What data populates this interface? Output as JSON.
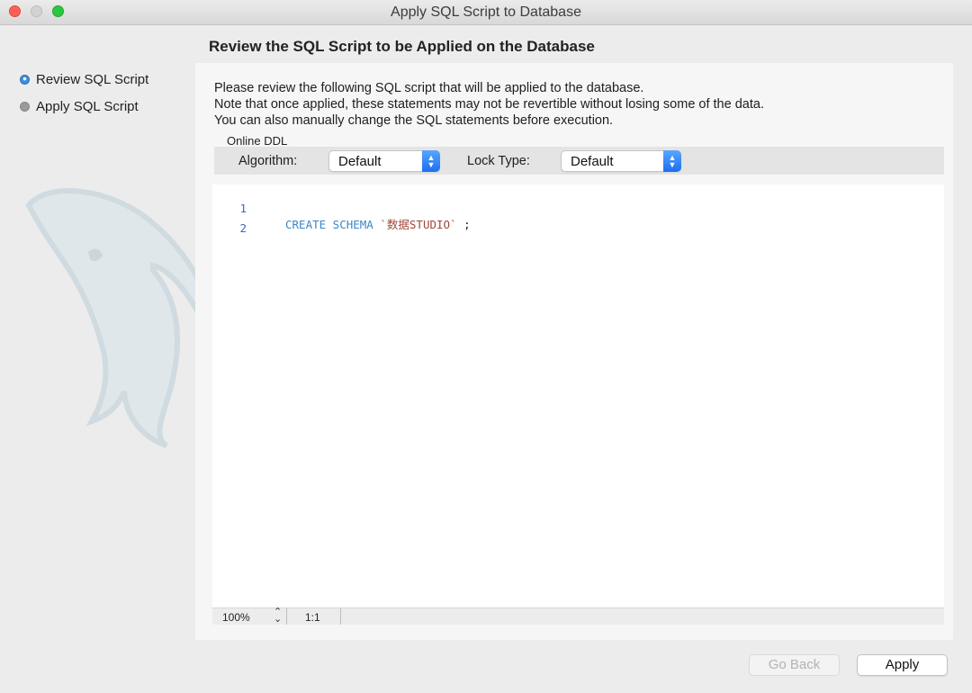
{
  "window": {
    "title": "Apply SQL Script to Database"
  },
  "sidebar": {
    "steps": [
      {
        "label": "Review SQL Script",
        "state": "active"
      },
      {
        "label": "Apply SQL Script",
        "state": "inactive"
      }
    ]
  },
  "main": {
    "heading": "Review the SQL Script to be Applied on the Database",
    "description": [
      "Please review the following SQL script that will be applied to the database.",
      "Note that once applied, these statements may not be revertible without losing some of the data.",
      "You can also manually change the SQL statements before execution."
    ],
    "online_ddl": {
      "group_label": "Online DDL",
      "algorithm_label": "Algorithm:",
      "algorithm_value": "Default",
      "lock_type_label": "Lock Type:",
      "lock_type_value": "Default"
    },
    "editor": {
      "lines": [
        {
          "number": "1",
          "keyword": "CREATE SCHEMA",
          "identifier": "`数据STUDIO`",
          "terminator": " ;"
        },
        {
          "number": "2",
          "keyword": "",
          "identifier": "",
          "terminator": ""
        }
      ]
    },
    "statusbar": {
      "zoom": "100%",
      "cursor": "1:1"
    }
  },
  "footer": {
    "go_back_label": "Go Back",
    "apply_label": "Apply"
  },
  "colors": {
    "accent": "#1b6ff0",
    "close": "#fd5f57",
    "zoom": "#2ac840",
    "keyword": "#3d86c8",
    "identifier": "#a0463a"
  },
  "icons": [
    "close-icon",
    "minimize-icon",
    "zoom-icon",
    "step-active-icon",
    "step-inactive-icon",
    "chevron-updown-icon",
    "mysql-dolphin-logo"
  ]
}
